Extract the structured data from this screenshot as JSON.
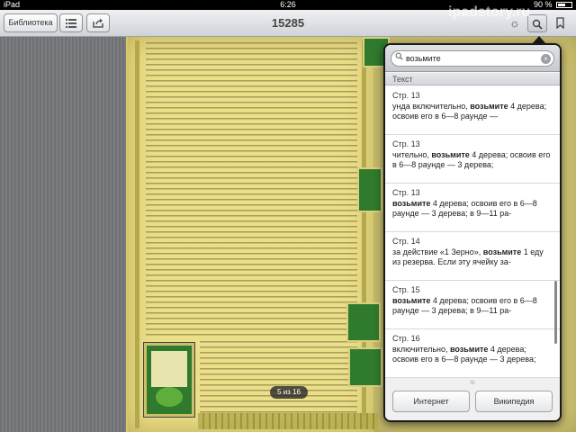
{
  "status": {
    "device": "iPad",
    "time": "6:26",
    "battery": "90 %"
  },
  "toolbar": {
    "library_label": "Библиотека",
    "list_icon": "list-icon",
    "share_icon": "share-icon",
    "title": "15285",
    "brightness_icon": "brightness-icon",
    "search_icon": "search-icon",
    "bookmark_icon": "bookmark-icon"
  },
  "reader": {
    "page_counter": "5 из 16"
  },
  "watermark": "ipadstory.ru",
  "search": {
    "query": "возьмите",
    "section_label": "Текст",
    "results": [
      {
        "page": "Стр. 13",
        "before": "унда включительно, ",
        "match": "возьмите",
        "after": " 4 дерева; освоив его в 6—8 раунде —"
      },
      {
        "page": "Стр. 13",
        "before": "чительно, ",
        "match": "возьмите",
        "after": " 4 дерева; освоив его в 6—8 раунде — 3 дерева;"
      },
      {
        "page": "Стр. 13",
        "before": "",
        "match": "возьмите",
        "after": " 4 дерева; освоив его в 6—8 раунде — 3 дерева; в 9—11 ра-"
      },
      {
        "page": "Стр. 14",
        "before": "за действие «1 Зерно», ",
        "match": "возьмите",
        "after": " 1 еду из резерва. Если эту ячейку за-"
      },
      {
        "page": "Стр. 15",
        "before": "",
        "match": "возьмите",
        "after": " 4 дерева; освоив его в 6—8 раунде — 3 дерева; в 9—11 ра-"
      },
      {
        "page": "Стр. 16",
        "before": "включительно, ",
        "match": "возьмите",
        "after": " 4 дерева; освоив его в 6—8 раунде — 3 дерева;"
      }
    ],
    "internet_label": "Интернет",
    "wiki_label": "Википедия"
  }
}
